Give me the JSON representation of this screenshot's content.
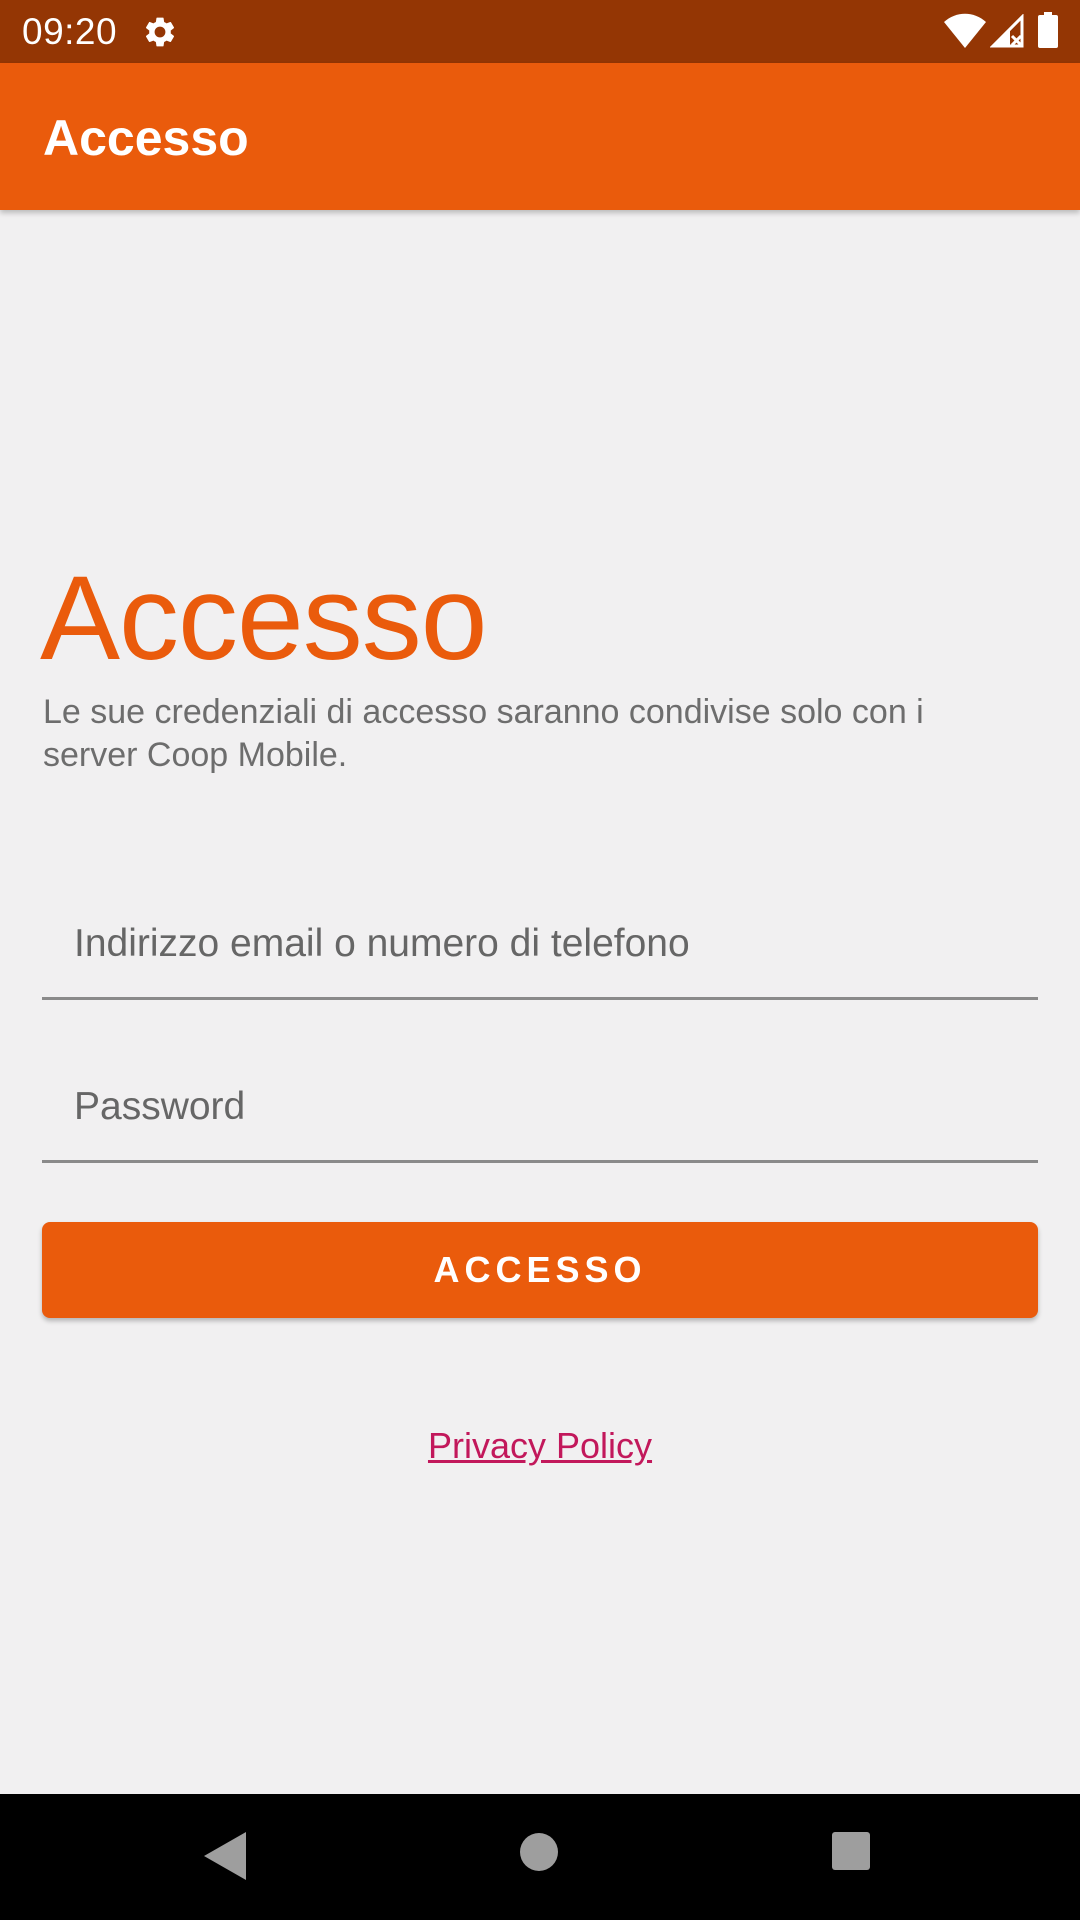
{
  "status_bar": {
    "time": "09:20",
    "icons": [
      "gear-icon",
      "wifi-icon",
      "signal-icon",
      "battery-icon"
    ]
  },
  "app_bar": {
    "title": "Accesso"
  },
  "main": {
    "heading": "Accesso",
    "subtitle": "Le sue credenziali di accesso saranno condivise solo con i server Coop Mobile.",
    "email_field": {
      "value": "",
      "placeholder": "Indirizzo email o numero di telefono"
    },
    "password_field": {
      "value": "",
      "placeholder": "Password"
    },
    "login_button_label": "ACCESSO",
    "privacy_link": "Privacy Policy"
  },
  "nav_bar": {
    "icons": [
      "back-icon",
      "home-icon",
      "recents-icon"
    ]
  },
  "colors": {
    "status_bar": "#943604",
    "accent": "#ea5b0c",
    "background": "#f1f0f1",
    "subtitle_text": "#6d6d6d",
    "link": "#c2185b"
  }
}
